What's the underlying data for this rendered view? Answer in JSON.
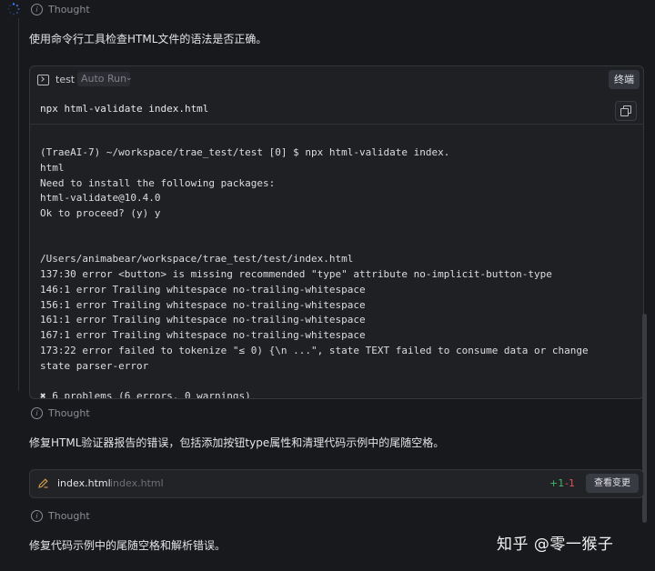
{
  "thought_label": "Thought",
  "intro_text": "使用命令行工具检查HTML文件的语法是否正确。",
  "terminal": {
    "name": "test",
    "auto_run": "Auto Run",
    "terminal_button": "终端",
    "command": "npx html-validate index.html",
    "output_lines": [
      "(TraeAI-7) ~/workspace/trae_test/test [0] $ npx html-validate index.",
      "html",
      "Need to install the following packages:",
      "html-validate@10.4.0",
      "Ok to proceed? (y) y",
      "",
      "",
      "/Users/animabear/workspace/trae_test/test/index.html",
      "137:30 error <button> is missing recommended \"type\" attribute no-implicit-button-type",
      "146:1 error Trailing whitespace no-trailing-whitespace",
      "156:1 error Trailing whitespace no-trailing-whitespace",
      "161:1 error Trailing whitespace no-trailing-whitespace",
      "167:1 error Trailing whitespace no-trailing-whitespace",
      "173:22 error failed to tokenize \"≤ 0) {\\n ...\", state TEXT failed to consume data or change",
      "state parser-error",
      "",
      "✖ 6 problems (6 errors, 0 warnings)"
    ]
  },
  "fix_text": "修复HTML验证器报告的错误，包括添加按钮type属性和清理代码示例中的尾随空格。",
  "file_change": {
    "file_name": "index.html",
    "file_path": "index.html",
    "additions": "+1",
    "deletions": "-1",
    "view_button": "查看变更"
  },
  "final_text": "修复代码示例中的尾随空格和解析错误。",
  "watermark": "知乎 @零一猴子"
}
